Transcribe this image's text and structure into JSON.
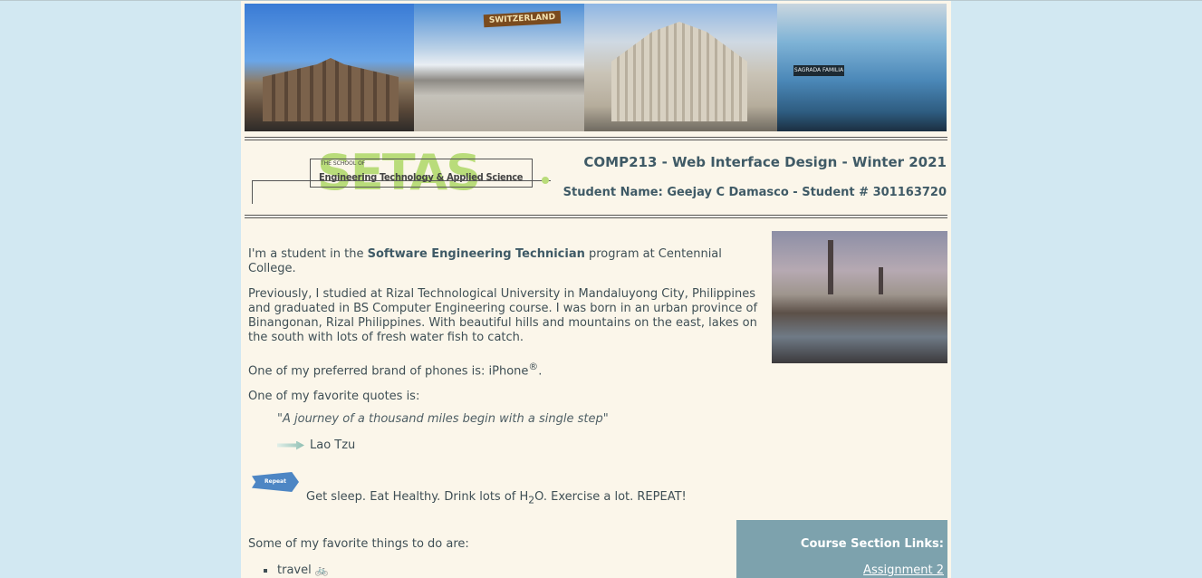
{
  "banner": {
    "photo2_sign": "SWITZERLAND",
    "photo4_sign": "SAGRADA FAMILIA"
  },
  "header": {
    "logo_big": "SETAS",
    "logo_small": "THE SCHOOL OF",
    "logo_sub": "Engineering Technology & Applied Science",
    "course_title": "COMP213 - Web Interface Design - Winter 2021",
    "student_line": "Student Name: Geejay C Damasco - Student # 301163720"
  },
  "intro": {
    "p1_pre": "I'm a student in the ",
    "p1_bold": "Software Engineering Technician",
    "p1_post": " program at Centennial College.",
    "p2": "Previously, I studied at Rizal Technological University in Mandaluyong City, Philippines and graduated in BS Computer Engineering course. I was born in an urban province of Binangonan, Rizal Philippines. With beautiful hills and mountains on the east, lakes on the south with lots of fresh water fish to catch.",
    "p3_pre": "One of my preferred brand of phones is: iPhone",
    "p3_sup": "®",
    "p3_post": ".",
    "p4": "One of my favorite quotes is:"
  },
  "quote": {
    "text": "\"A journey of a thousand miles begin with a single step\"",
    "author": "Lao Tzu"
  },
  "repeat": {
    "badge": "Repeat",
    "text_pre": "Get sleep. Eat Healthy. Drink lots of H",
    "text_sub": "2",
    "text_post": "O. Exercise a lot. REPEAT!"
  },
  "favorites": {
    "heading": "Some of my favorite things to do are:",
    "items": [
      "travel"
    ]
  },
  "links": {
    "title": "Course Section Links:",
    "items": [
      "Assignment 2"
    ]
  }
}
